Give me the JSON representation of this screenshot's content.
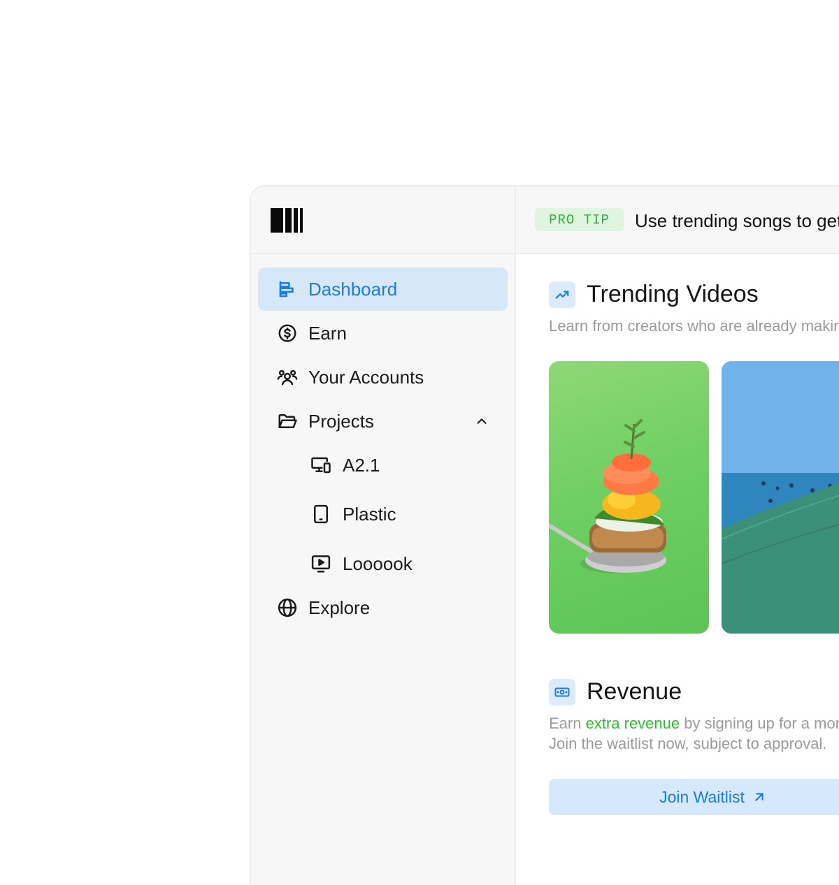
{
  "sidebar": {
    "items": [
      {
        "label": "Dashboard",
        "icon": "dashboard-chart-icon",
        "active": true
      },
      {
        "label": "Earn",
        "icon": "dollar-circle-icon"
      },
      {
        "label": "Your Accounts",
        "icon": "users-group-icon"
      },
      {
        "label": "Projects",
        "icon": "folder-open-icon",
        "expanded": true
      },
      {
        "label": "Explore",
        "icon": "globe-icon"
      }
    ],
    "projects": [
      {
        "label": "A2.1",
        "icon": "devices-icon"
      },
      {
        "label": "Plastic",
        "icon": "tablet-icon"
      },
      {
        "label": "Loooook",
        "icon": "video-player-icon"
      }
    ]
  },
  "topbar": {
    "badge": "PRO TIP",
    "tip": "Use trending songs to get more views"
  },
  "trending": {
    "title": "Trending Videos",
    "description": "Learn from creators who are already making money"
  },
  "revenue": {
    "title": "Revenue",
    "desc_prefix": "Earn ",
    "desc_highlight": "extra revenue",
    "desc_suffix": " by signing up for a monetization plan.",
    "desc_line2": "Join the waitlist now, subject to approval.",
    "button_label": "Join Waitlist"
  },
  "colors": {
    "accent": "#1a7de0",
    "active_bg": "#d6e7fa",
    "green": "#2fbd2f",
    "badge_bg": "#dff5df"
  }
}
